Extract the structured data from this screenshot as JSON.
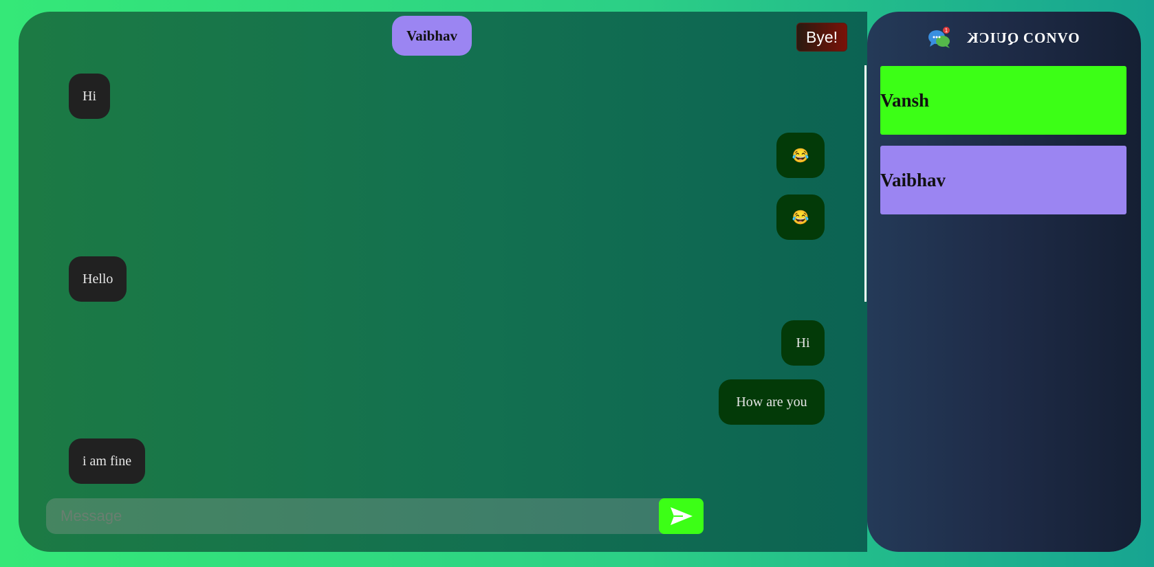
{
  "chat": {
    "active_contact": "Vaibhav",
    "bye_label": "Bye!",
    "messages": [
      {
        "text": "Hi",
        "direction": "incoming"
      },
      {
        "text": "😂",
        "direction": "outgoing"
      },
      {
        "text": "😂",
        "direction": "outgoing"
      },
      {
        "text": "Hello",
        "direction": "incoming"
      },
      {
        "text": "Hi",
        "direction": "outgoing"
      },
      {
        "text": "How are you",
        "direction": "outgoing"
      },
      {
        "text": "i am fine",
        "direction": "incoming"
      }
    ],
    "input": {
      "placeholder": "Message",
      "value": ""
    },
    "send_icon": "send-arrow-icon"
  },
  "sidebar": {
    "brand_left": "QUICK",
    "brand_right": " CONVO",
    "brand_icon": "chat-bubbles-icon",
    "notification_count": "1",
    "contacts": [
      {
        "name": "Vansh",
        "color": "#3cff16"
      },
      {
        "name": "Vaibhav",
        "color": "#9b85f2"
      }
    ]
  },
  "colors": {
    "incoming_bubble": "#212121",
    "outgoing_bubble": "#033a08",
    "accent_green": "#3cff16",
    "accent_purple": "#9b85f2"
  }
}
